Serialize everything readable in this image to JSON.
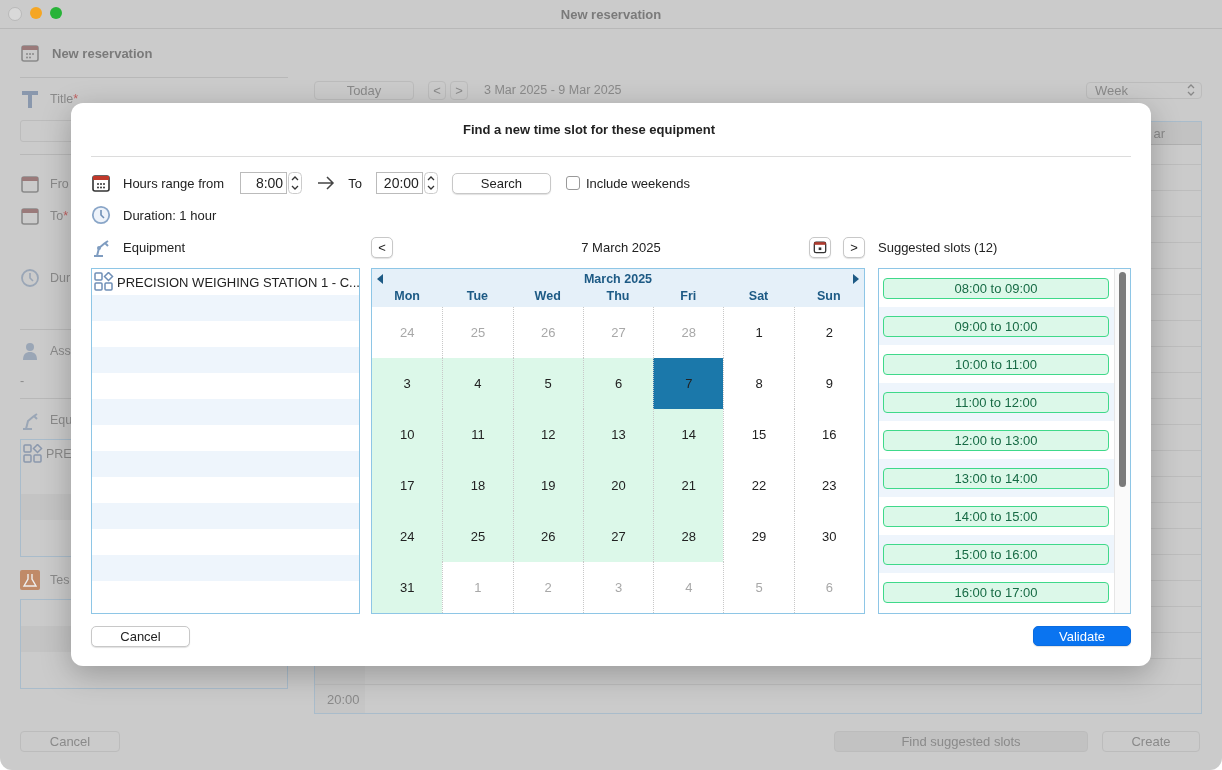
{
  "window": {
    "title": "New reservation"
  },
  "form": {
    "header": "New reservation",
    "title_label": "Title",
    "title_mark": "*",
    "from_label": "Fro",
    "to_label": "To",
    "to_mark": "*",
    "duration_label": "Dur",
    "assignee_label": "Ass",
    "assignee_value": "-",
    "equipment_label": "Equ",
    "equipment_items": [
      "PRE"
    ],
    "tests_label": "Tes",
    "cancel": "Cancel"
  },
  "schedule": {
    "today": "Today",
    "prev": "<",
    "next": ">",
    "range": "3 Mar 2025 - 9 Mar 2025",
    "view": "Week",
    "column_header": "ar",
    "time_label": "20:00",
    "find": "Find suggested slots",
    "create": "Create"
  },
  "dialog": {
    "title": "Find a new time slot for these equipment",
    "hours_label": "Hours range from",
    "from_value": "8:00",
    "to_label": "To",
    "to_value": "20:00",
    "search": "Search",
    "include_weekends": {
      "label": "Include weekends",
      "checked": false
    },
    "duration": "Duration: 1 hour",
    "equipment_label": "Equipment",
    "equipment": [
      "PRECISION WEIGHING STATION 1 - C..."
    ],
    "date_nav": {
      "prev": "<",
      "date": "7 March 2025",
      "next": ">"
    },
    "slots_label": "Suggested slots (12)",
    "calendar": {
      "month": "March 2025",
      "weekdays": [
        "Mon",
        "Tue",
        "Wed",
        "Thu",
        "Fri",
        "Sat",
        "Sun"
      ],
      "weeks": [
        [
          {
            "day": "24",
            "in_month": false,
            "available": false,
            "selected": false
          },
          {
            "day": "25",
            "in_month": false,
            "available": false,
            "selected": false
          },
          {
            "day": "26",
            "in_month": false,
            "available": false,
            "selected": false
          },
          {
            "day": "27",
            "in_month": false,
            "available": false,
            "selected": false
          },
          {
            "day": "28",
            "in_month": false,
            "available": false,
            "selected": false
          },
          {
            "day": "1",
            "in_month": true,
            "available": false,
            "selected": false
          },
          {
            "day": "2",
            "in_month": true,
            "available": false,
            "selected": false
          }
        ],
        [
          {
            "day": "3",
            "in_month": true,
            "available": true,
            "selected": false
          },
          {
            "day": "4",
            "in_month": true,
            "available": true,
            "selected": false
          },
          {
            "day": "5",
            "in_month": true,
            "available": true,
            "selected": false
          },
          {
            "day": "6",
            "in_month": true,
            "available": true,
            "selected": false
          },
          {
            "day": "7",
            "in_month": true,
            "available": true,
            "selected": true
          },
          {
            "day": "8",
            "in_month": true,
            "available": false,
            "selected": false
          },
          {
            "day": "9",
            "in_month": true,
            "available": false,
            "selected": false
          }
        ],
        [
          {
            "day": "10",
            "in_month": true,
            "available": true,
            "selected": false
          },
          {
            "day": "11",
            "in_month": true,
            "available": true,
            "selected": false
          },
          {
            "day": "12",
            "in_month": true,
            "available": true,
            "selected": false
          },
          {
            "day": "13",
            "in_month": true,
            "available": true,
            "selected": false
          },
          {
            "day": "14",
            "in_month": true,
            "available": true,
            "selected": false
          },
          {
            "day": "15",
            "in_month": true,
            "available": false,
            "selected": false
          },
          {
            "day": "16",
            "in_month": true,
            "available": false,
            "selected": false
          }
        ],
        [
          {
            "day": "17",
            "in_month": true,
            "available": true,
            "selected": false
          },
          {
            "day": "18",
            "in_month": true,
            "available": true,
            "selected": false
          },
          {
            "day": "19",
            "in_month": true,
            "available": true,
            "selected": false
          },
          {
            "day": "20",
            "in_month": true,
            "available": true,
            "selected": false
          },
          {
            "day": "21",
            "in_month": true,
            "available": true,
            "selected": false
          },
          {
            "day": "22",
            "in_month": true,
            "available": false,
            "selected": false
          },
          {
            "day": "23",
            "in_month": true,
            "available": false,
            "selected": false
          }
        ],
        [
          {
            "day": "24",
            "in_month": true,
            "available": true,
            "selected": false
          },
          {
            "day": "25",
            "in_month": true,
            "available": true,
            "selected": false
          },
          {
            "day": "26",
            "in_month": true,
            "available": true,
            "selected": false
          },
          {
            "day": "27",
            "in_month": true,
            "available": true,
            "selected": false
          },
          {
            "day": "28",
            "in_month": true,
            "available": true,
            "selected": false
          },
          {
            "day": "29",
            "in_month": true,
            "available": false,
            "selected": false
          },
          {
            "day": "30",
            "in_month": true,
            "available": false,
            "selected": false
          }
        ],
        [
          {
            "day": "31",
            "in_month": true,
            "available": true,
            "selected": false
          },
          {
            "day": "1",
            "in_month": false,
            "available": false,
            "selected": false
          },
          {
            "day": "2",
            "in_month": false,
            "available": false,
            "selected": false
          },
          {
            "day": "3",
            "in_month": false,
            "available": false,
            "selected": false
          },
          {
            "day": "4",
            "in_month": false,
            "available": false,
            "selected": false
          },
          {
            "day": "5",
            "in_month": false,
            "available": false,
            "selected": false
          },
          {
            "day": "6",
            "in_month": false,
            "available": false,
            "selected": false
          }
        ]
      ]
    },
    "slots": [
      "08:00 to 09:00",
      "09:00 to 10:00",
      "10:00 to 11:00",
      "11:00 to 12:00",
      "12:00 to 13:00",
      "13:00 to 14:00",
      "14:00 to 15:00",
      "15:00 to 16:00",
      "16:00 to 17:00"
    ],
    "cancel": "Cancel",
    "validate": "Validate"
  }
}
